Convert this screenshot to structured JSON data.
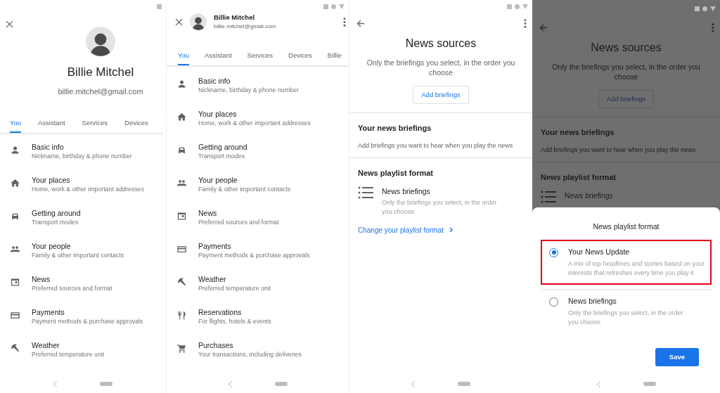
{
  "screens": [
    {
      "kind": "profile",
      "name": "Billie Mitchel",
      "email": "billie.mitchel@gmail.com",
      "tabs": [
        {
          "label": "You",
          "selected": true
        },
        {
          "label": "Assistant",
          "selected": false
        },
        {
          "label": "Services",
          "selected": false
        },
        {
          "label": "Devices",
          "selected": false
        }
      ],
      "items": [
        {
          "kind": "person",
          "title": "Basic info",
          "subtitle": "Nickname, birthday & phone number"
        },
        {
          "kind": "home",
          "title": "Your places",
          "subtitle": "Home, work & other important addresses"
        },
        {
          "kind": "car",
          "title": "Getting around",
          "subtitle": "Transport modes"
        },
        {
          "kind": "people",
          "title": "Your people",
          "subtitle": "Family & other important contacts"
        },
        {
          "kind": "news",
          "title": "News",
          "subtitle": "Preferred sources and format"
        },
        {
          "kind": "card",
          "title": "Payments",
          "subtitle": "Payment methods & purchase approvals"
        },
        {
          "kind": "weather",
          "title": "Weather",
          "subtitle": "Preferred temperature unit"
        }
      ]
    },
    {
      "kind": "profile_compact",
      "name": "Billie Mitchel",
      "email": "billie.mitchel@gmail.com",
      "tabs": [
        {
          "label": "You",
          "selected": true
        },
        {
          "label": "Assistant",
          "selected": false
        },
        {
          "label": "Services",
          "selected": false
        },
        {
          "label": "Devices",
          "selected": false
        },
        {
          "label": "Billie",
          "selected": false
        }
      ],
      "items": [
        {
          "kind": "person",
          "title": "Basic info",
          "subtitle": "Nickname, birthday & phone number"
        },
        {
          "kind": "home",
          "title": "Your places",
          "subtitle": "Home, work & other important addresses"
        },
        {
          "kind": "car",
          "title": "Getting around",
          "subtitle": "Transport modes"
        },
        {
          "kind": "people",
          "title": "Your people",
          "subtitle": "Family & other important contacts"
        },
        {
          "kind": "news",
          "title": "News",
          "subtitle": "Preferred sources and format"
        },
        {
          "kind": "card",
          "title": "Payments",
          "subtitle": "Payment methods & purchase approvals"
        },
        {
          "kind": "weather",
          "title": "Weather",
          "subtitle": "Preferred temperature unit"
        },
        {
          "kind": "restaurant",
          "title": "Reservations",
          "subtitle": "For flights, hotels & events"
        },
        {
          "kind": "cart",
          "title": "Purchases",
          "subtitle": "Your transactions, including deliveries"
        }
      ]
    },
    {
      "kind": "news_sources",
      "title": "News sources",
      "subtitle": "Only the briefings you select, in the order you choose",
      "button": "Add briefings",
      "briefings": {
        "heading": "Your news briefings",
        "text": "Add briefings you want to hear when you play the news"
      },
      "format": {
        "heading": "News playlist format",
        "title": "News briefings",
        "text": "Only the briefings you select, in the order you choose"
      },
      "link": "Change your playlist format"
    },
    {
      "kind": "news_sources_sheet",
      "title": "News sources",
      "subtitle": "Only the briefings you select, in the order you choose",
      "button": "Add briefings",
      "briefings": {
        "heading": "Your news briefings",
        "text": "Add briefings you want to hear when you play the news"
      },
      "format": {
        "heading": "News playlist format",
        "title": "News briefings"
      },
      "sheet": {
        "title": "News playlist format",
        "options": [
          {
            "title": "Your News Update",
            "text": "A mix of top headlines and stories based on your interests that refreshes every time you play it",
            "selected": true,
            "highlighted": true
          },
          {
            "title": "News briefings",
            "text": "Only the briefings you select, in the order you choose",
            "selected": false,
            "highlighted": false
          }
        ],
        "button": "Save"
      }
    }
  ]
}
